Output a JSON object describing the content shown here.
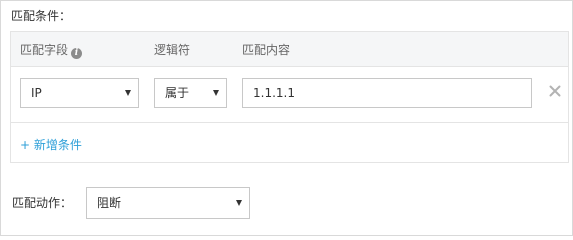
{
  "match_conditions": {
    "label": "匹配条件：",
    "headers": {
      "field": "匹配字段",
      "operator": "逻辑符",
      "value": "匹配内容"
    },
    "row": {
      "field": "IP",
      "operator": "属于",
      "value": "1.1.1.1"
    },
    "add_label": "+ 新增条件"
  },
  "match_action": {
    "label": "匹配动作：",
    "value": "阻断"
  },
  "icons": {
    "info": "info-icon",
    "remove": "close-icon",
    "dropdown": "caret-down-icon"
  },
  "colors": {
    "link": "#2d9fd8",
    "header_bg": "#f5f6f7"
  }
}
